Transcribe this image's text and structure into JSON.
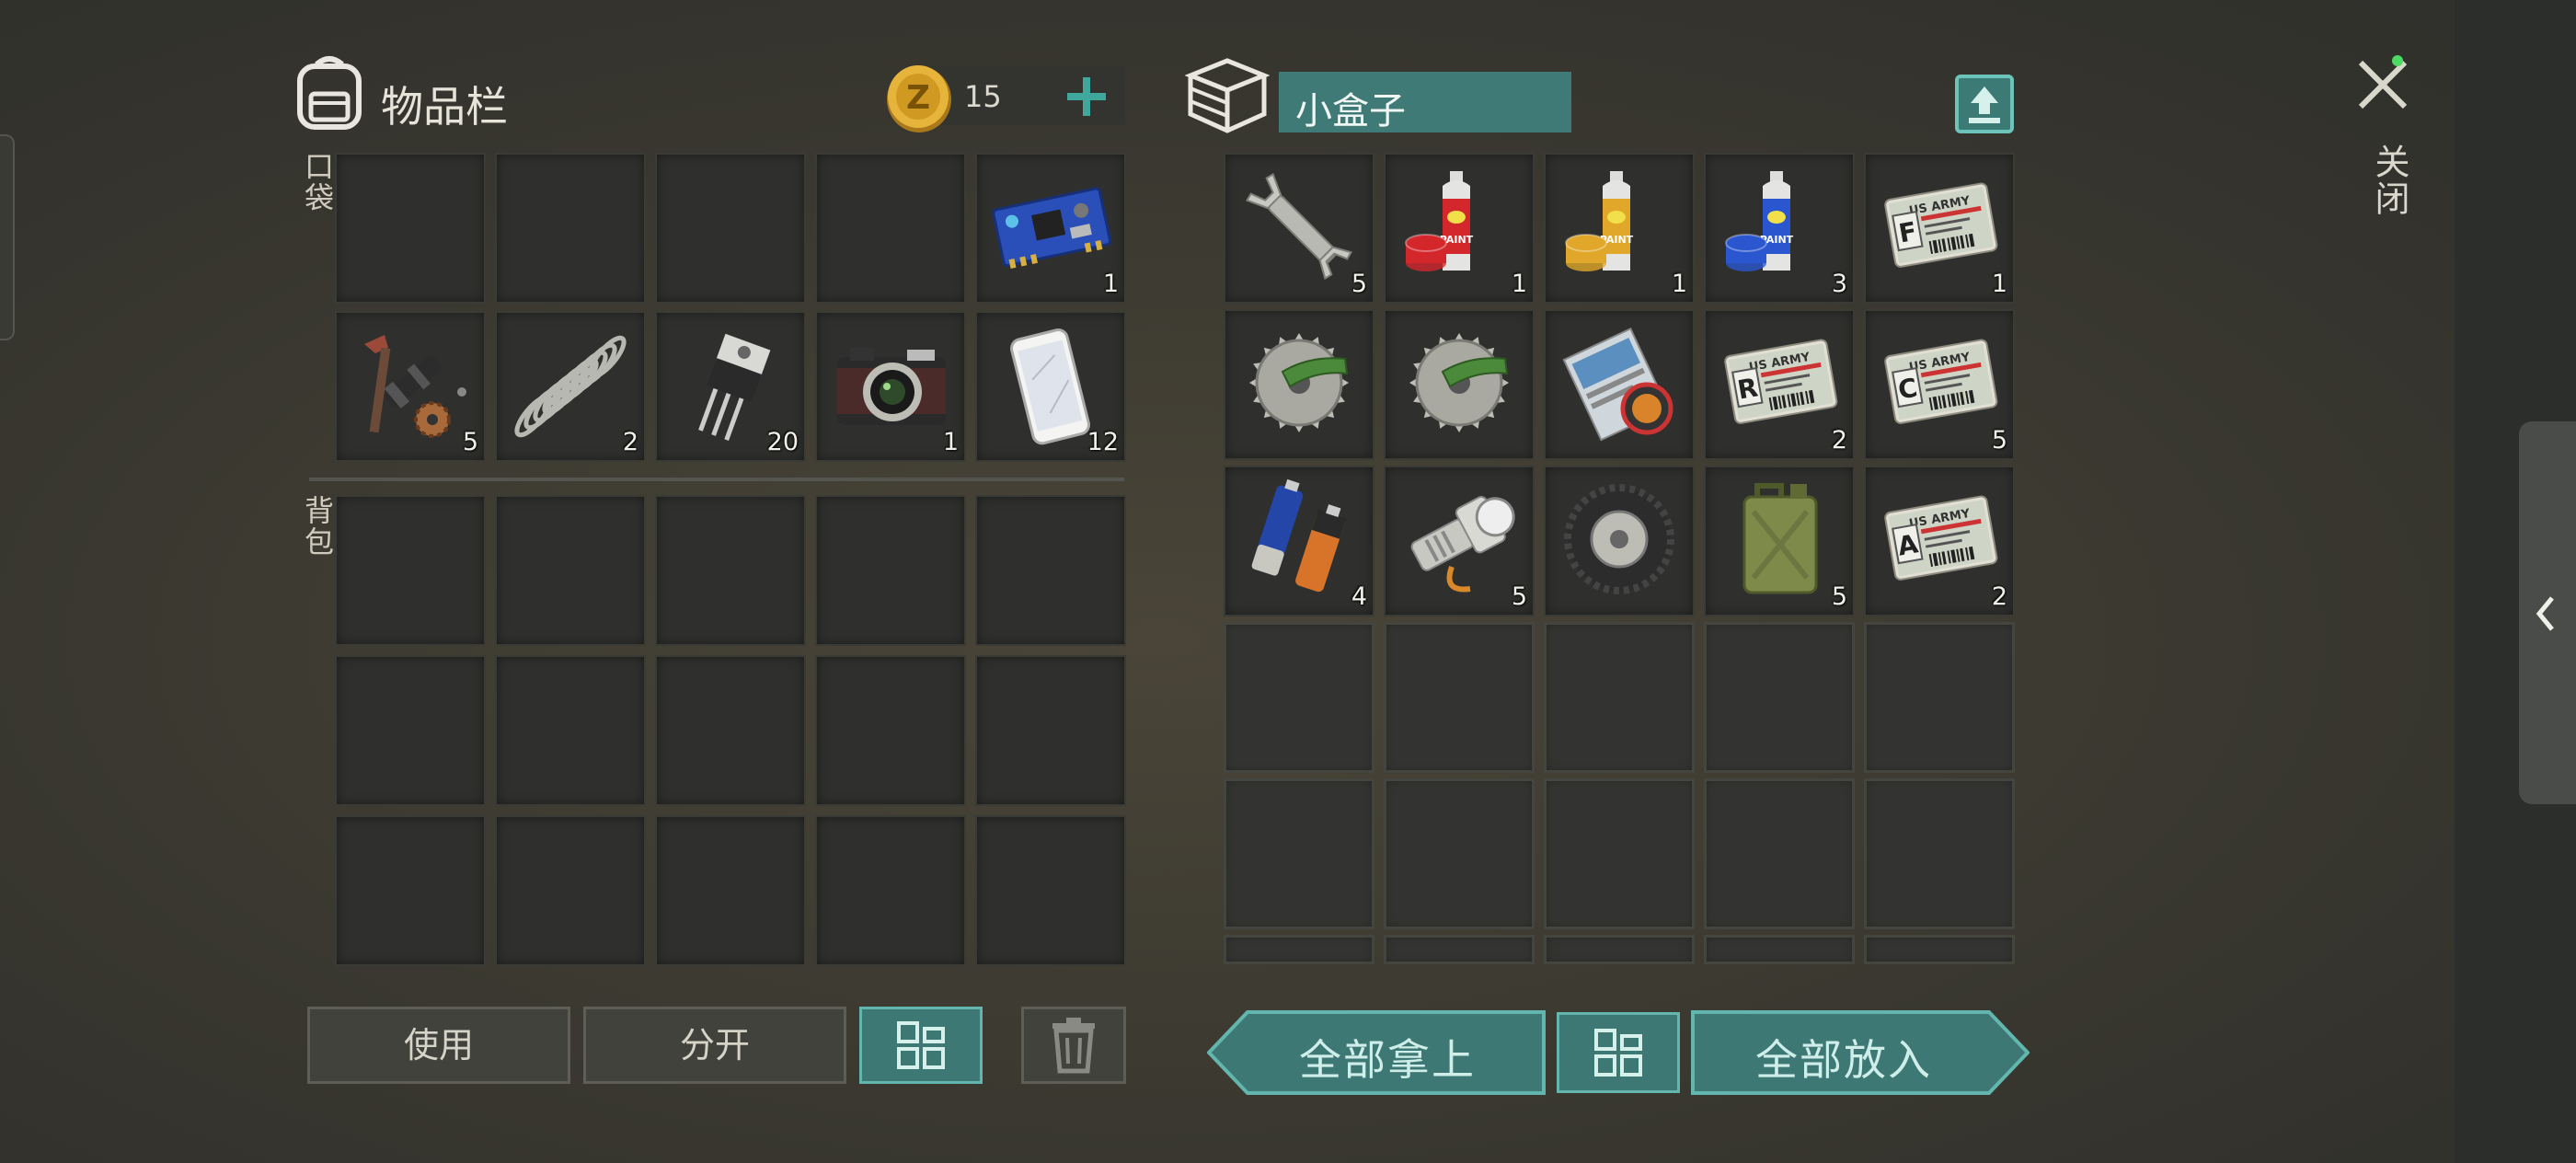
{
  "inventory": {
    "title": "物品栏",
    "coins": "15",
    "pocket_label": "口袋",
    "backpack_label": "背包",
    "pocket_items": [
      {
        "icon": "empty"
      },
      {
        "icon": "empty"
      },
      {
        "icon": "empty"
      },
      {
        "icon": "empty"
      },
      {
        "icon": "circuit-board-icon",
        "count": "1"
      },
      {
        "icon": "tool-parts-icon",
        "count": "5"
      },
      {
        "icon": "spring-icon",
        "count": "2"
      },
      {
        "icon": "transistor-icon",
        "count": "20"
      },
      {
        "icon": "camera-icon",
        "count": "1"
      },
      {
        "icon": "smartphone-icon",
        "count": "12"
      }
    ]
  },
  "container": {
    "title": "小盒子",
    "items": [
      {
        "icon": "wrench-icon",
        "count": "5"
      },
      {
        "icon": "spray-paint-red-icon",
        "count": "1",
        "color": "#d3272c"
      },
      {
        "icon": "spray-paint-yellow-icon",
        "count": "1",
        "color": "#e0a72a"
      },
      {
        "icon": "spray-paint-blue-icon",
        "count": "3",
        "color": "#2a57cf"
      },
      {
        "icon": "army-card-f-icon",
        "count": "1",
        "letter": "F"
      },
      {
        "icon": "saw-blade-icon",
        "count": ""
      },
      {
        "icon": "saw-blade-icon",
        "count": ""
      },
      {
        "icon": "magazine-icon",
        "count": ""
      },
      {
        "icon": "army-card-r-icon",
        "count": "2",
        "letter": "R"
      },
      {
        "icon": "army-card-c-icon",
        "count": "5",
        "letter": "C"
      },
      {
        "icon": "batteries-icon",
        "count": "4"
      },
      {
        "icon": "flashlight-icon",
        "count": "5"
      },
      {
        "icon": "tire-icon",
        "count": ""
      },
      {
        "icon": "jerrycan-icon",
        "count": "5"
      },
      {
        "icon": "army-card-a-icon",
        "count": "2",
        "letter": "A"
      }
    ],
    "card_text": "US ARMY",
    "paint_text": "PAINT"
  },
  "buttons": {
    "use": "使用",
    "split": "分开",
    "take_all": "全部拿上",
    "put_all": "全部放入"
  },
  "close_label": "关闭",
  "colors": {
    "accent": "#3e7875",
    "accent_border": "#62b6ae",
    "notify_dot": "#4cd964"
  }
}
